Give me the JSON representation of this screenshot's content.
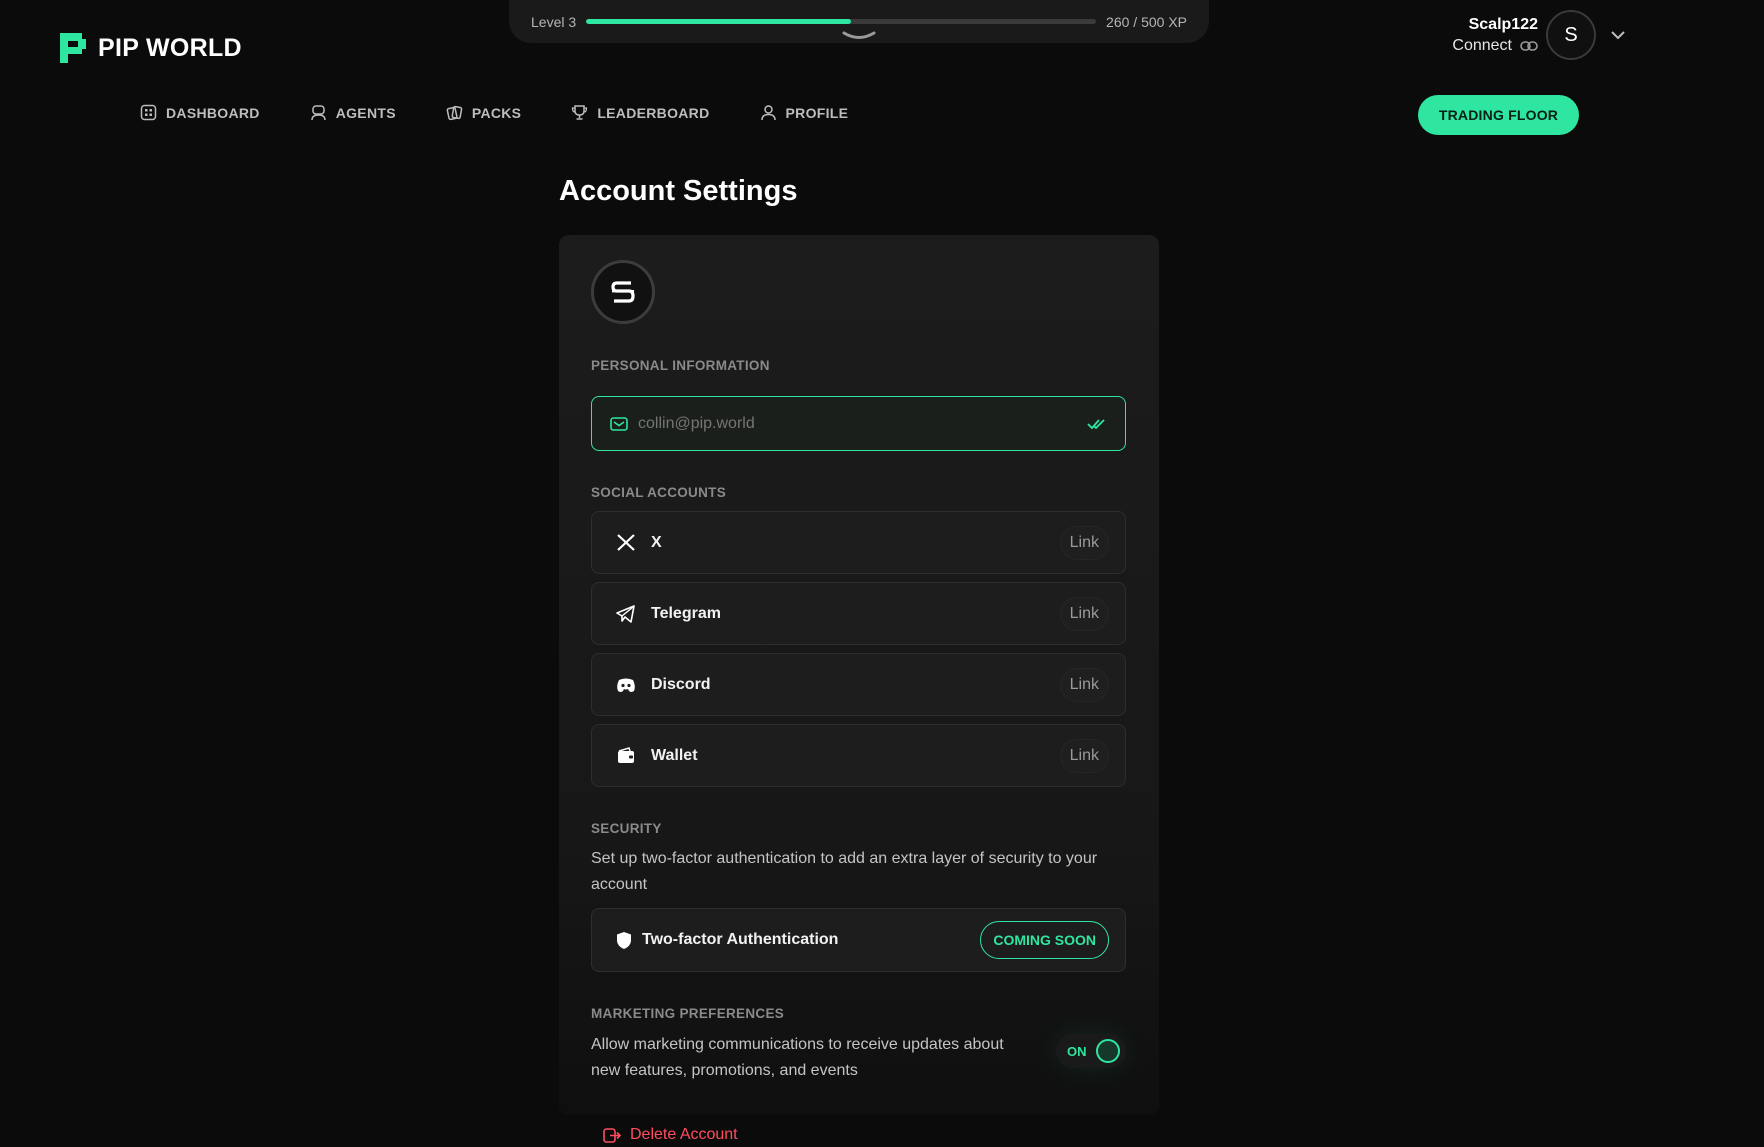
{
  "brand": {
    "name": "PIP WORLD",
    "accent": "#2fe6a0"
  },
  "xp": {
    "level_label": "Level 3",
    "current": 260,
    "max": 500,
    "progress": 0.52,
    "text": "260 / 500 XP"
  },
  "user": {
    "name": "Scalp122",
    "connect_label": "Connect",
    "avatar_letter": "S"
  },
  "nav": {
    "items": [
      {
        "label": "DASHBOARD",
        "icon": "dashboard-icon"
      },
      {
        "label": "AGENTS",
        "icon": "agent-icon"
      },
      {
        "label": "PACKS",
        "icon": "cards-icon"
      },
      {
        "label": "LEADERBOARD",
        "icon": "trophy-icon"
      },
      {
        "label": "PROFILE",
        "icon": "user-icon"
      }
    ],
    "cta_label": "TRADING FLOOR"
  },
  "page": {
    "title": "Account Settings",
    "personal": {
      "label": "PERSONAL INFORMATION",
      "email_placeholder": "collin@pip.world"
    },
    "social": {
      "label": "SOCIAL ACCOUNTS",
      "accounts": [
        {
          "name": "X",
          "icon": "x-icon",
          "action": "Link"
        },
        {
          "name": "Telegram",
          "icon": "telegram-icon",
          "action": "Link"
        },
        {
          "name": "Discord",
          "icon": "discord-icon",
          "action": "Link"
        },
        {
          "name": "Wallet",
          "icon": "wallet-icon",
          "action": "Link"
        }
      ]
    },
    "security": {
      "label": "SECURITY",
      "description": "Set up two-factor authentication to add an extra layer of security to your account",
      "tfa_label": "Two-factor Authentication",
      "tfa_status": "COMING SOON"
    },
    "marketing": {
      "label": "MARKETING PREFERENCES",
      "description": "Allow marketing communications to receive updates about new features, promotions, and events",
      "toggle_label": "ON",
      "enabled": true
    },
    "delete_label": "Delete Account"
  }
}
